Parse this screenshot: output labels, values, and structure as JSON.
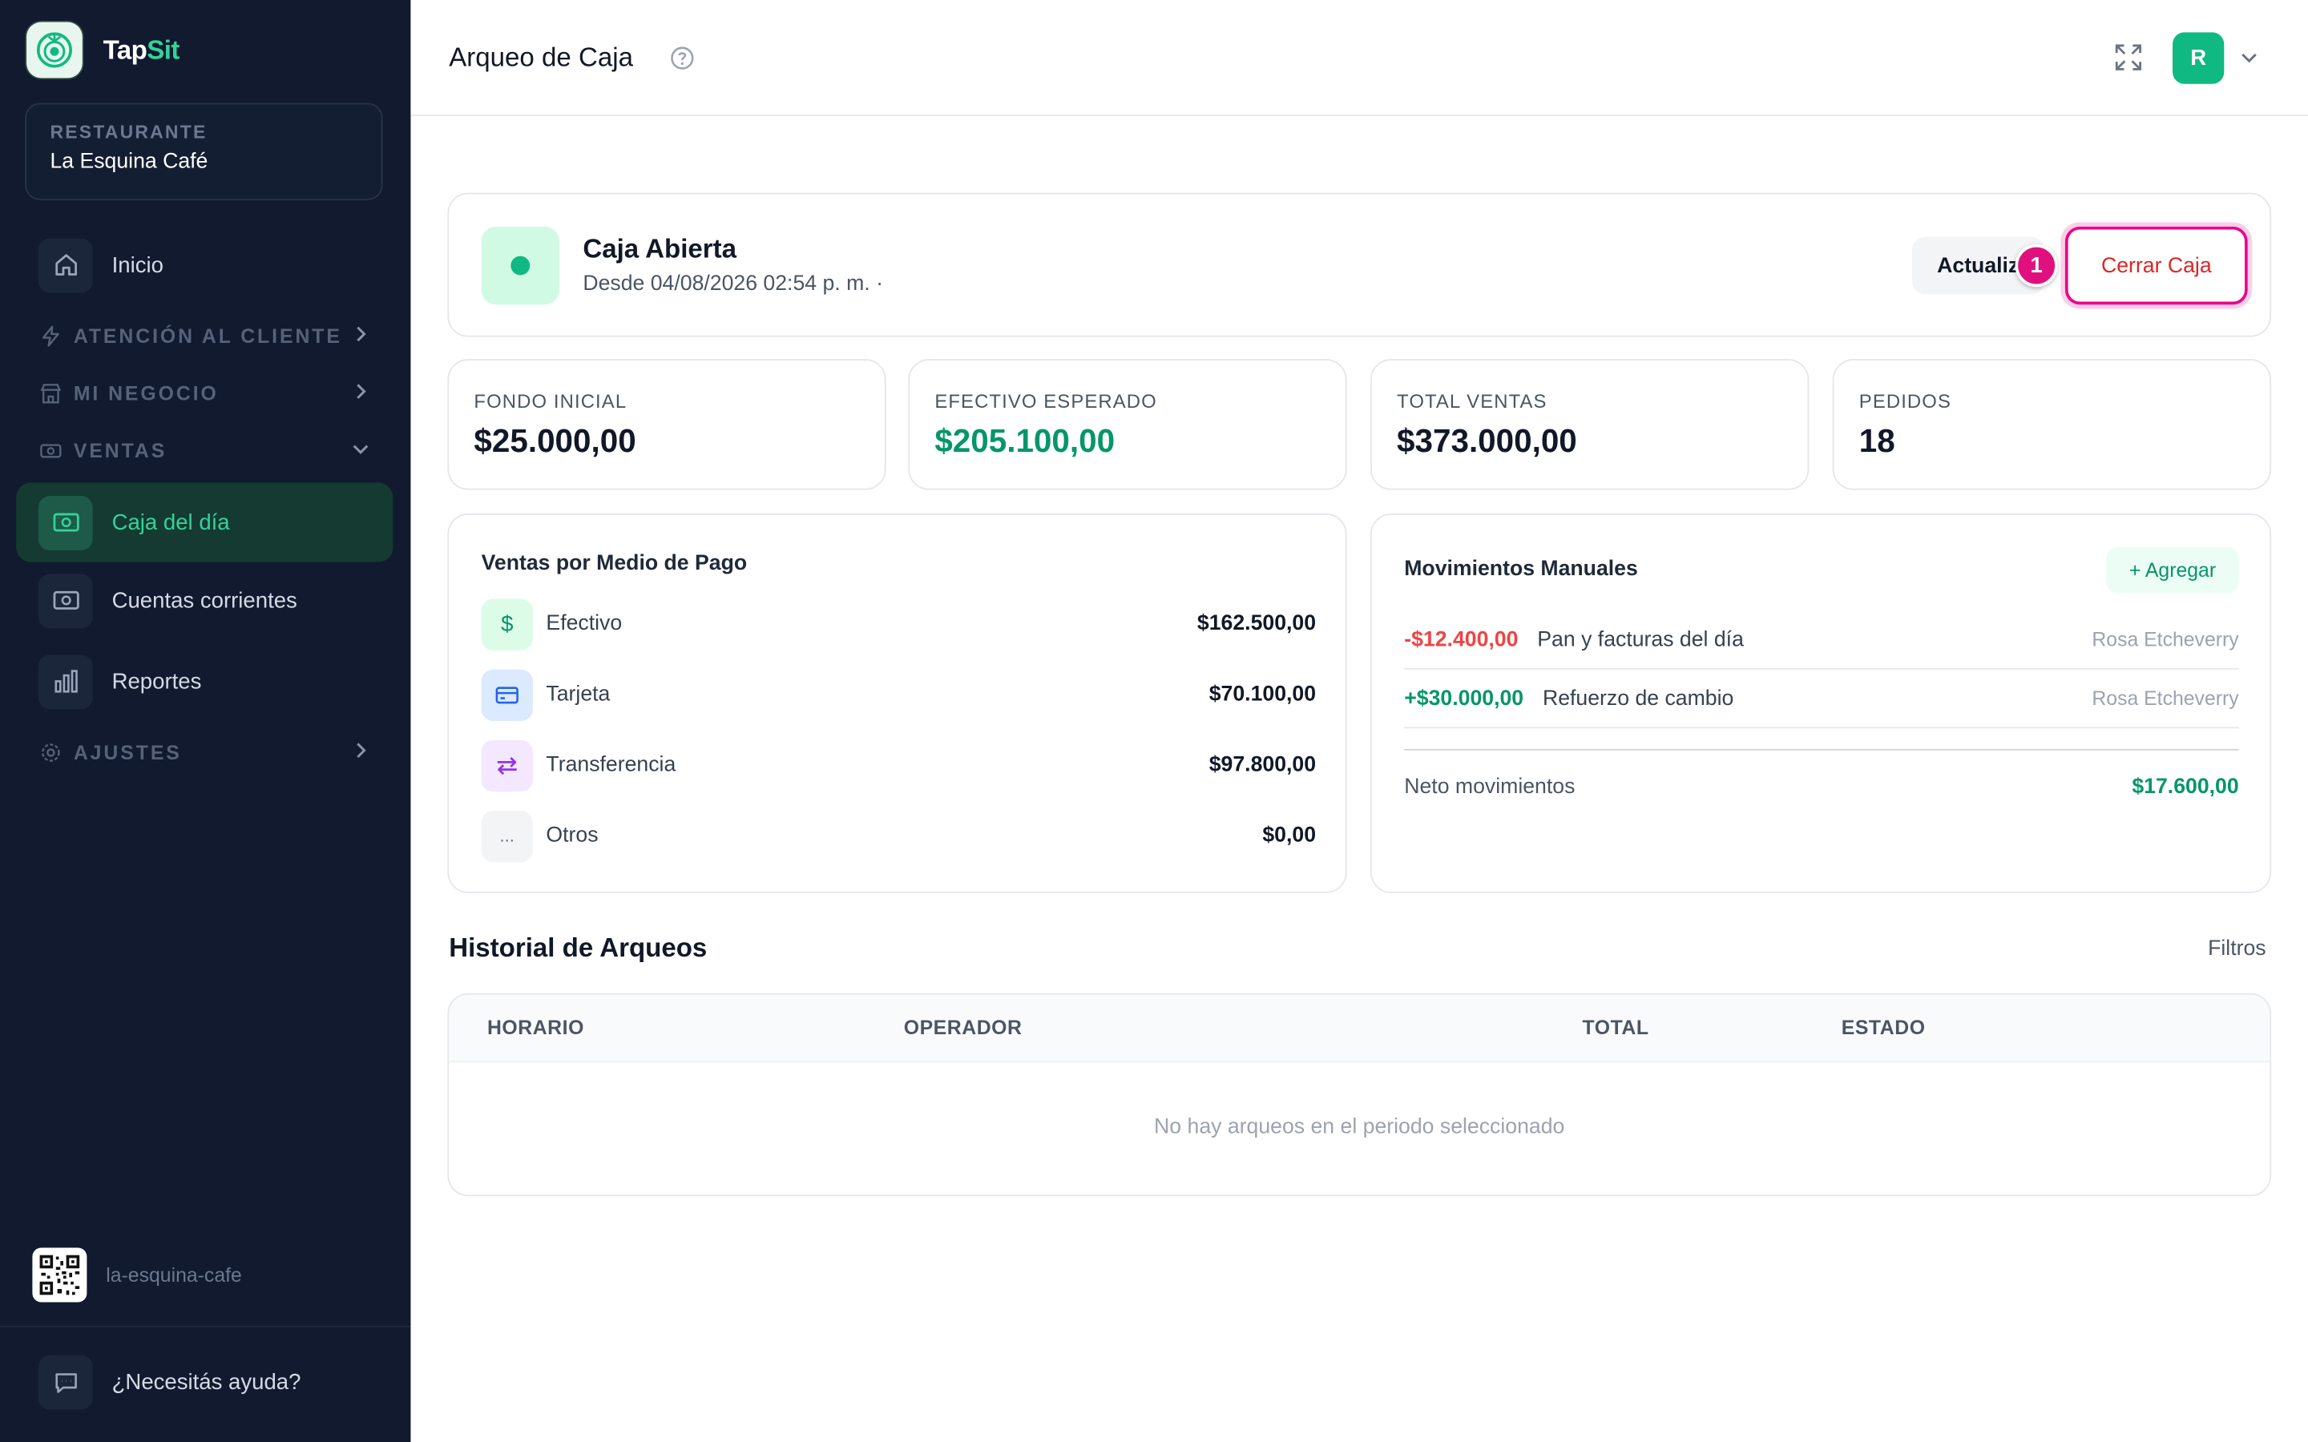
{
  "brand": {
    "name_main": "Tap",
    "name_accent": "Sit"
  },
  "restaurant": {
    "label": "RESTAURANTE",
    "name": "La Esquina Café"
  },
  "sidebar": {
    "home": "Inicio",
    "sections": {
      "atencion": "ATENCIÓN AL CLIENTE",
      "negocio": "MI NEGOCIO",
      "ventas": "VENTAS",
      "ajustes": "AJUSTES"
    },
    "items": {
      "caja": "Caja del día",
      "cuentas": "Cuentas corrientes",
      "reportes": "Reportes"
    },
    "qr_slug": "la-esquina-cafe",
    "help": "¿Necesitás ayuda?"
  },
  "header": {
    "title": "Arqueo de Caja",
    "avatar_initial": "R"
  },
  "status": {
    "title": "Caja Abierta",
    "since": "Desde 04/08/2026 02:54 p. m. ·",
    "refresh_label": "Actualizar",
    "close_label": "Cerrar Caja",
    "step_badge": "1"
  },
  "stats": [
    {
      "label": "FONDO INICIAL",
      "value": "$25.000,00"
    },
    {
      "label": "EFECTIVO ESPERADO",
      "value": "$205.100,00"
    },
    {
      "label": "TOTAL VENTAS",
      "value": "$373.000,00"
    },
    {
      "label": "PEDIDOS",
      "value": "18"
    }
  ],
  "payments": {
    "title": "Ventas por Medio de Pago",
    "rows": [
      {
        "icon": "$",
        "label": "Efectivo",
        "value": "$162.500,00"
      },
      {
        "icon": "card-icon",
        "label": "Tarjeta",
        "value": "$70.100,00"
      },
      {
        "icon": "transfer-icon",
        "label": "Transferencia",
        "value": "$97.800,00"
      },
      {
        "icon": "...",
        "label": "Otros",
        "value": "$0,00"
      }
    ]
  },
  "movements": {
    "title": "Movimientos Manuales",
    "add_label": "+ Agregar",
    "rows": [
      {
        "amount": "-$12.400,00",
        "desc": "Pan y facturas del día",
        "operator": "Rosa Etcheverry"
      },
      {
        "amount": "+$30.000,00",
        "desc": "Refuerzo de cambio",
        "operator": "Rosa Etcheverry"
      }
    ],
    "net_label": "Neto movimientos",
    "net_value": "$17.600,00"
  },
  "history": {
    "title": "Historial de Arqueos",
    "filters": "Filtros",
    "columns": [
      "HORARIO",
      "OPERADOR",
      "TOTAL",
      "ESTADO"
    ],
    "empty": "No hay arqueos en el periodo seleccionado"
  },
  "colors": {
    "accent": "#10b981",
    "sidebar_bg": "#111a2e",
    "danger": "#dc2626",
    "highlight": "#ec008c"
  }
}
